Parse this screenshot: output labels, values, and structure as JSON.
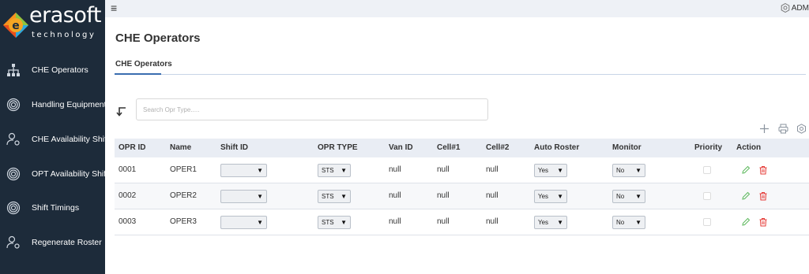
{
  "brand": {
    "name": "erasoft",
    "tagline": "technology"
  },
  "sidebar": {
    "items": [
      {
        "label": "CHE Operators",
        "icon": "org-chart-icon"
      },
      {
        "label": "Handling Equipment",
        "icon": "spiral-icon"
      },
      {
        "label": "CHE Availability Shift",
        "icon": "user-settings-icon"
      },
      {
        "label": "OPT Availability Shift",
        "icon": "spiral-icon"
      },
      {
        "label": "Shift Timings",
        "icon": "spiral-icon"
      },
      {
        "label": "Regenerate Roster",
        "icon": "user-settings-icon"
      }
    ]
  },
  "topbar": {
    "menu_icon": "≡",
    "user": "ADM"
  },
  "page": {
    "title": "CHE Operators",
    "tab": "CHE Operators"
  },
  "search": {
    "placeholder": "Search Opr Type....."
  },
  "table": {
    "columns": [
      "OPR ID",
      "Name",
      "Shift ID",
      "OPR TYPE",
      "Van ID",
      "Cell#1",
      "Cell#2",
      "Auto Roster",
      "Monitor",
      "Priority",
      "Action"
    ],
    "rows": [
      {
        "opr_id": "0001",
        "name": "OPER1",
        "shift_id": "",
        "opr_type": "STS",
        "van_id": "null",
        "cell1": "null",
        "cell2": "null",
        "auto_roster": "Yes",
        "monitor": "No"
      },
      {
        "opr_id": "0002",
        "name": "OPER2",
        "shift_id": "",
        "opr_type": "STS",
        "van_id": "null",
        "cell1": "null",
        "cell2": "null",
        "auto_roster": "Yes",
        "monitor": "No"
      },
      {
        "opr_id": "0003",
        "name": "OPER3",
        "shift_id": "",
        "opr_type": "STS",
        "van_id": "null",
        "cell1": "null",
        "cell2": "null",
        "auto_roster": "Yes",
        "monitor": "No"
      }
    ]
  },
  "colors": {
    "sidebar_bg": "#1d2b3a",
    "accent": "#3a6db0",
    "edit": "#5cb85c",
    "delete": "#e53935",
    "logo_e": "#f5a623"
  }
}
